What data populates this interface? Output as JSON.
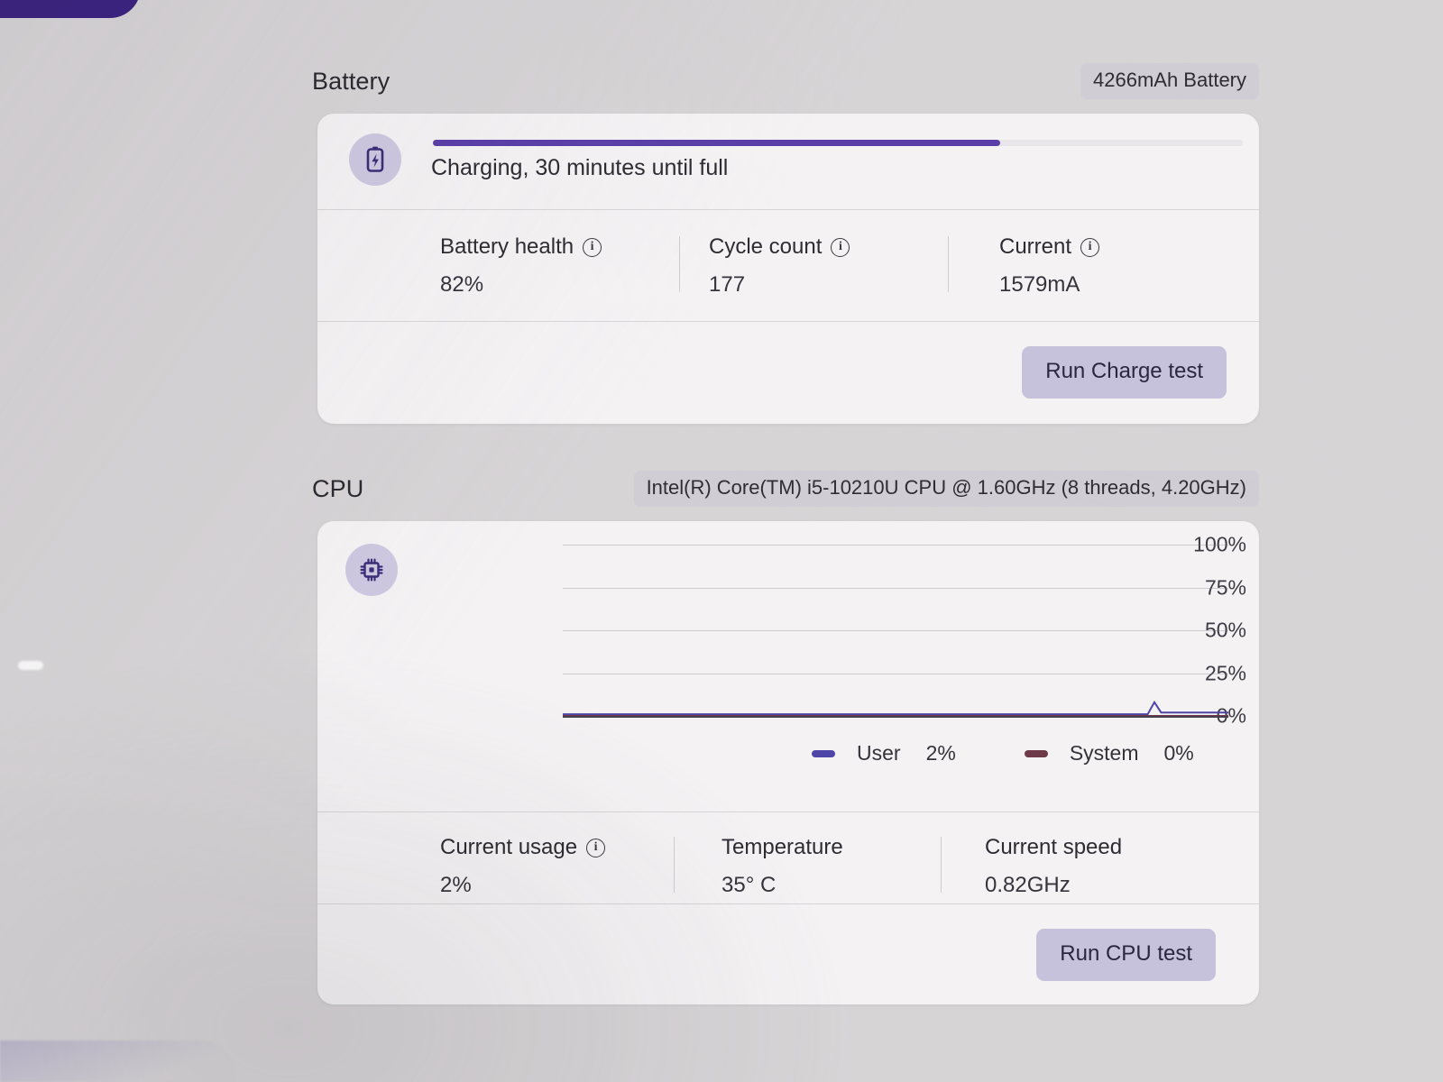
{
  "battery": {
    "section_title": "Battery",
    "capacity_chip": "4266mAh Battery",
    "icon": "battery-charging-icon",
    "status_text": "Charging, 30 minutes until full",
    "charge_percent": 70,
    "stats": [
      {
        "label": "Battery health",
        "value": "82%",
        "has_info": true,
        "info_icon": "info-icon"
      },
      {
        "label": "Cycle count",
        "value": "177",
        "has_info": true,
        "info_icon": "info-icon"
      },
      {
        "label": "Current",
        "value": "1579mA",
        "has_info": true,
        "info_icon": "info-icon"
      }
    ],
    "action_label": "Run Charge test"
  },
  "cpu": {
    "section_title": "CPU",
    "model_chip": "Intel(R) Core(TM) i5-10210U CPU @ 1.60GHz (8 threads, 4.20GHz)",
    "icon": "cpu-chip-icon",
    "stats": [
      {
        "label": "Current usage",
        "value": "2%",
        "has_info": true,
        "info_icon": "info-icon"
      },
      {
        "label": "Temperature",
        "value": "35° C",
        "has_info": false
      },
      {
        "label": "Current speed",
        "value": "0.82GHz",
        "has_info": false
      }
    ],
    "action_label": "Run CPU test"
  },
  "chart_data": {
    "type": "line",
    "title": "",
    "xlabel": "",
    "ylabel": "",
    "ylim": [
      0,
      100
    ],
    "yticks": [
      100,
      75,
      50,
      25,
      0
    ],
    "ytick_labels": [
      "100%",
      "75%",
      "50%",
      "25%",
      "0%"
    ],
    "grid": true,
    "legend_position": "bottom-right",
    "colors": {
      "user": "#4d45a8",
      "system": "#6e3a4a"
    },
    "series": [
      {
        "name": "User",
        "value_label": "2%",
        "color": "#4d45a8",
        "values": [
          1,
          1,
          1,
          1,
          1,
          1,
          1,
          1,
          1,
          1,
          1,
          1,
          1,
          1,
          1,
          1,
          1,
          1,
          1,
          1,
          1,
          1,
          1,
          1,
          1,
          1,
          1,
          1,
          1,
          1,
          1,
          1,
          1,
          1,
          1,
          1,
          1,
          1,
          1,
          1,
          1,
          1,
          1,
          1,
          1,
          1,
          1,
          1,
          1,
          1,
          1,
          1,
          1,
          1,
          1,
          1,
          1,
          1,
          1,
          1,
          1,
          1,
          1,
          1,
          1,
          1,
          1,
          1,
          1,
          1,
          1,
          1,
          1,
          1,
          1,
          1,
          1,
          1,
          1,
          1,
          1,
          1,
          1,
          1,
          1,
          1,
          1,
          1,
          8,
          2,
          2,
          2,
          2,
          2,
          2,
          2,
          2,
          2,
          2,
          2
        ]
      },
      {
        "name": "System",
        "value_label": "0%",
        "color": "#6e3a4a",
        "values": [
          0,
          0,
          0,
          0,
          0,
          0,
          0,
          0,
          0,
          0,
          0,
          0,
          0,
          0,
          0,
          0,
          0,
          0,
          0,
          0,
          0,
          0,
          0,
          0,
          0,
          0,
          0,
          0,
          0,
          0,
          0,
          0,
          0,
          0,
          0,
          0,
          0,
          0,
          0,
          0,
          0,
          0,
          0,
          0,
          0,
          0,
          0,
          0,
          0,
          0,
          0,
          0,
          0,
          0,
          0,
          0,
          0,
          0,
          0,
          0,
          0,
          0,
          0,
          0,
          0,
          0,
          0,
          0,
          0,
          0,
          0,
          0,
          0,
          0,
          0,
          0,
          0,
          0,
          0,
          0,
          0,
          0,
          0,
          0,
          0,
          0,
          0,
          0,
          0,
          0,
          0,
          0,
          0,
          0,
          0,
          0,
          0,
          0,
          0,
          0
        ]
      }
    ]
  }
}
